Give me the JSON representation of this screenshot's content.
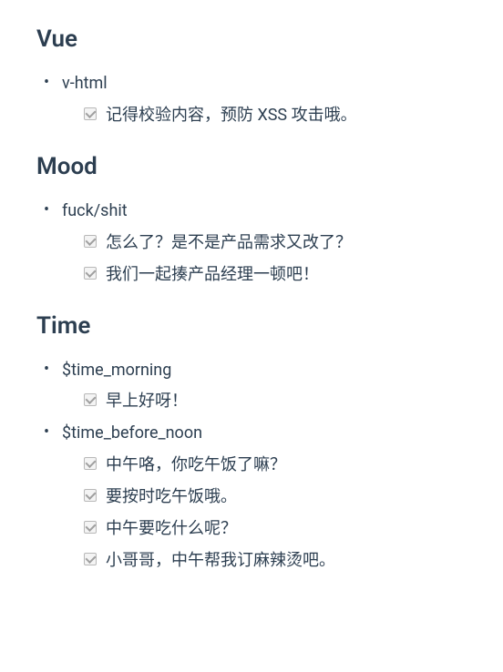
{
  "sections": [
    {
      "title": "Vue",
      "items": [
        {
          "label": "v-html",
          "children": [
            {
              "label": "记得校验内容，预防 XSS 攻击哦。"
            }
          ]
        }
      ]
    },
    {
      "title": "Mood",
      "items": [
        {
          "label": "fuck/shit",
          "children": [
            {
              "label": "怎么了？是不是产品需求又改了？"
            },
            {
              "label": "我们一起揍产品经理一顿吧！"
            }
          ]
        }
      ]
    },
    {
      "title": "Time",
      "items": [
        {
          "label": "$time_morning",
          "children": [
            {
              "label": "早上好呀！"
            }
          ]
        },
        {
          "label": "$time_before_noon",
          "children": [
            {
              "label": "中午咯，你吃午饭了嘛？"
            },
            {
              "label": "要按时吃午饭哦。"
            },
            {
              "label": "中午要吃什么呢？"
            },
            {
              "label": "小哥哥，中午帮我订麻辣烫吧。"
            }
          ]
        }
      ]
    }
  ]
}
